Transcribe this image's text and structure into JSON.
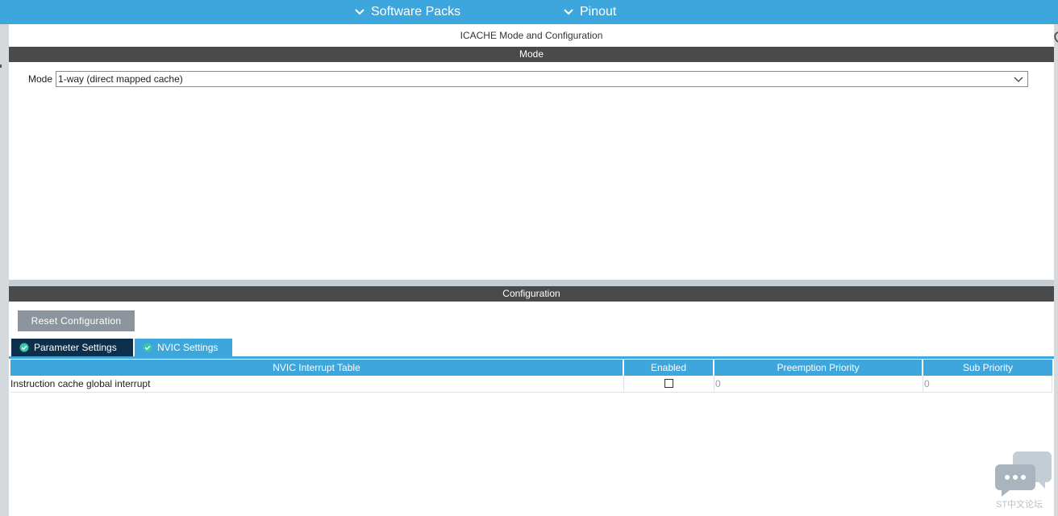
{
  "topbar": {
    "software_packs": "Software Packs",
    "pinout": "Pinout"
  },
  "mode_panel": {
    "title": "ICACHE Mode and Configuration",
    "section_header": "Mode",
    "mode_label": "Mode",
    "mode_value": "1-way (direct mapped cache)"
  },
  "config_panel": {
    "section_header": "Configuration",
    "reset_button": "Reset Configuration",
    "tabs": [
      {
        "label": "Parameter Settings"
      },
      {
        "label": "NVIC Settings"
      }
    ],
    "table": {
      "headers": [
        "NVIC Interrupt Table",
        "Enabled",
        "Preemption Priority",
        "Sub Priority"
      ],
      "rows": [
        {
          "name": "Instruction cache global interrupt",
          "enabled": false,
          "preemption": "0",
          "sub": "0"
        }
      ]
    }
  },
  "watermark": {
    "text": "ST中文论坛"
  },
  "colors": {
    "accent": "#3ca6dd",
    "header_dark": "#4a4a4a",
    "tab_selected": "#0e2f4c",
    "button_gray": "#8c959d"
  }
}
